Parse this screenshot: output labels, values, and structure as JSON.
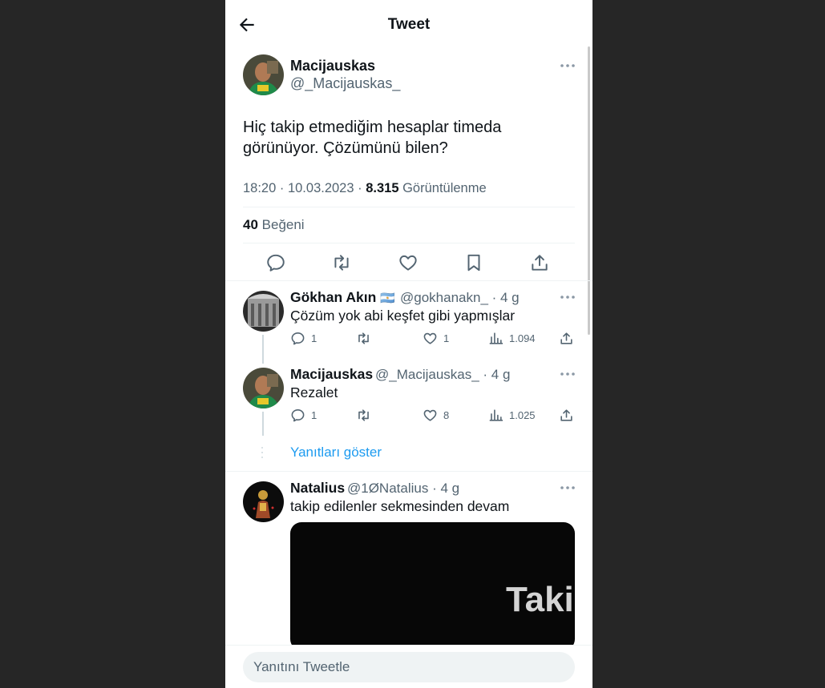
{
  "header": {
    "title": "Tweet"
  },
  "tweet": {
    "name": "Macijauskas",
    "handle": "@_Macijauskas_",
    "text": "Hiç takip etmediğim hesaplar timeda görünüyor. Çözümünü bilen?",
    "time_date": "18:20 · 10.03.2023 · ",
    "views_count": "8.315",
    "views_label": " Görüntülenme",
    "likes_count": "40",
    "likes_label": " Beğeni"
  },
  "replies": [
    {
      "name": "Gökhan Akın",
      "flag": "🇦🇷",
      "handle_time": "@gokhanakn_ · 4 g",
      "text": "Çözüm yok abi keşfet gibi yapmışlar",
      "reply_count": "1",
      "retweet_count": "",
      "like_count": "1",
      "view_count": "1.094"
    },
    {
      "name": "Macijauskas",
      "handle_time": "@_Macijauskas_ · 4 g",
      "text": "Rezalet",
      "reply_count": "1",
      "retweet_count": "",
      "like_count": "8",
      "view_count": "1.025"
    },
    {
      "name": "Natalius",
      "handle_time": "@1ØNatalius · 4 g",
      "text": "takip edilenler sekmesinden devam",
      "media_text": "Taki"
    }
  ],
  "show_replies_label": "Yanıtları göster",
  "composer": {
    "placeholder": "Yanıtını Tweetle"
  },
  "colors": {
    "accent": "#1d9bf0",
    "text": "#0f1419",
    "secondary": "#536471",
    "background": "#262626"
  }
}
